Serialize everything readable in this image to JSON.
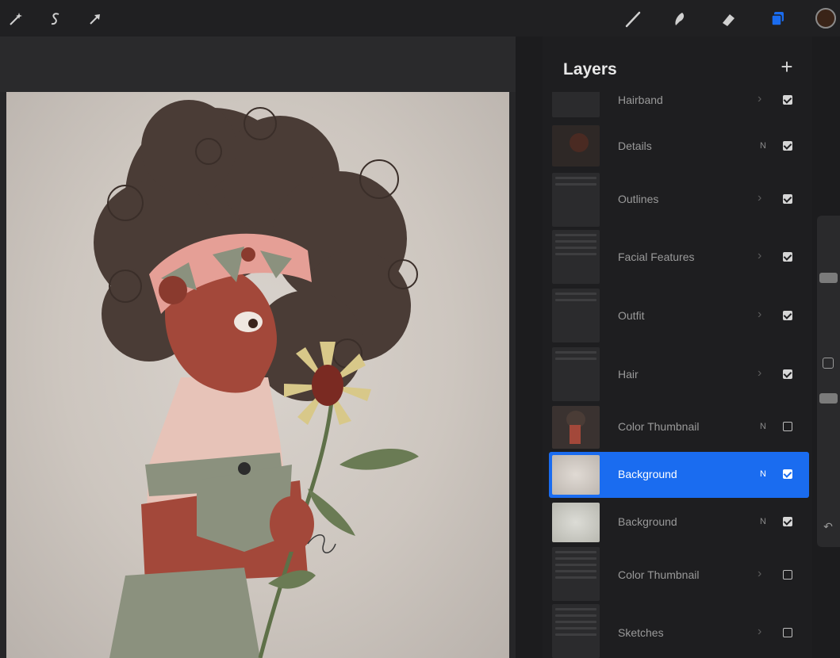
{
  "toolbar": {
    "left_tools": [
      "adjustments-wand-icon",
      "selection-s-icon",
      "transform-arrow-icon"
    ],
    "right_tools": [
      "brush-icon",
      "smudge-icon",
      "eraser-icon",
      "layers-icon"
    ],
    "active_tool": "layers-icon",
    "accent": "#1a6cf0",
    "color_swatch": "#3a2418"
  },
  "layers_panel": {
    "title": "Layers",
    "add_symbol": "+",
    "layers": [
      {
        "name": "Hairband",
        "mode": "",
        "group": true,
        "visible": true
      },
      {
        "name": "Details",
        "mode": "N",
        "group": false,
        "visible": true
      },
      {
        "name": "Outlines",
        "mode": "",
        "group": true,
        "visible": true
      },
      {
        "name": "Facial Features",
        "mode": "",
        "group": true,
        "visible": true
      },
      {
        "name": "Outfit",
        "mode": "",
        "group": true,
        "visible": true
      },
      {
        "name": "Hair",
        "mode": "",
        "group": true,
        "visible": true
      },
      {
        "name": "Color Thumbnail",
        "mode": "N",
        "group": false,
        "visible": false
      },
      {
        "name": "Background",
        "mode": "N",
        "group": false,
        "visible": true,
        "selected": true
      },
      {
        "name": "Background",
        "mode": "N",
        "group": false,
        "visible": true
      },
      {
        "name": "Color Thumbnail",
        "mode": "",
        "group": true,
        "visible": false
      },
      {
        "name": "Sketches",
        "mode": "",
        "group": true,
        "visible": false
      }
    ]
  },
  "sidebar": {
    "modify_icon": "square-icon",
    "undo_icon": "undo-icon"
  }
}
